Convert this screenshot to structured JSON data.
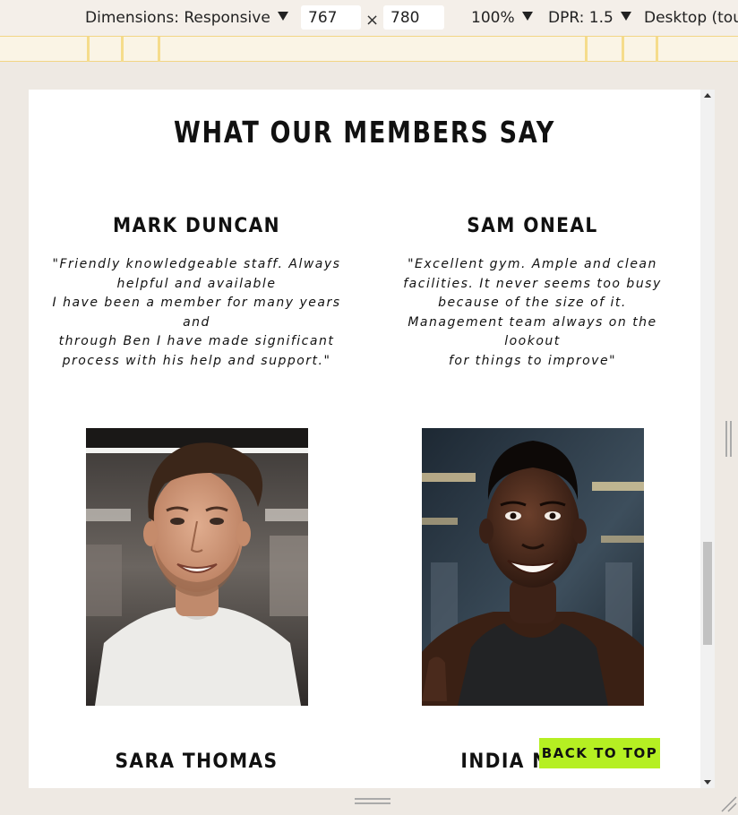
{
  "devtools": {
    "dimensions_label": "Dimensions: Responsive",
    "width_value": "767",
    "times": "×",
    "height_value": "780",
    "zoom": "100%",
    "dpr": "DPR: 1.5",
    "device_mode": "Desktop (touch)"
  },
  "page": {
    "section_title": "WHAT OUR MEMBERS SAY",
    "testimonials": [
      {
        "name": "MARK DUNCAN",
        "quote": "\"Friendly knowledgeable staff. Always\nhelpful and available\nI have been a member for many years and\nthrough Ben I have made significant\nprocess with his help and support.\""
      },
      {
        "name": "SAM ONEAL",
        "quote": "\"Excellent gym. Ample and clean\nfacilities. It never seems too busy\nbecause of the size of it.\nManagement team always on the lookout\nfor things to improve\""
      }
    ],
    "members_row2": [
      {
        "name": "SARA THOMAS"
      },
      {
        "name": "INDIA NIXON"
      }
    ],
    "back_to_top": "BACK TO TOP"
  },
  "colors": {
    "accent": "#b5ef22",
    "text": "#111111",
    "devtools_bg": "#f4efe9"
  }
}
